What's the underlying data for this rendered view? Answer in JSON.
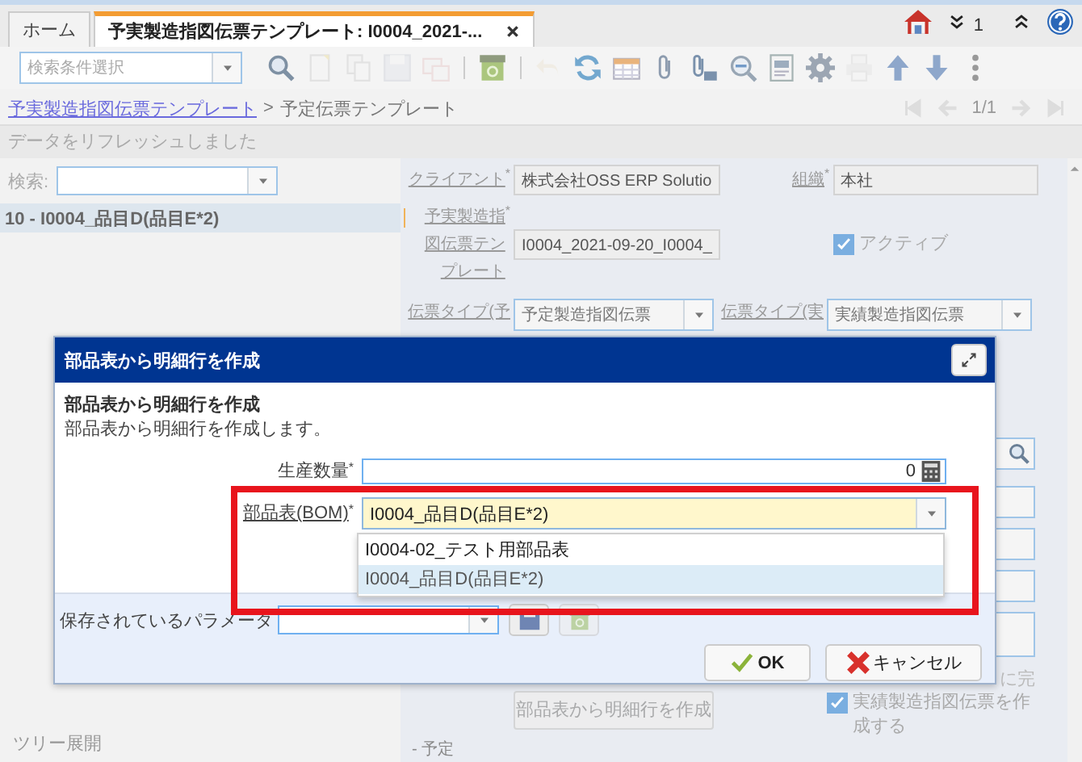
{
  "tabs": [
    {
      "label": "ホーム",
      "selected": false
    },
    {
      "label": "予実製造指図伝票テンプレート: I0004_2021-...",
      "selected": true,
      "closable": true
    }
  ],
  "tab_bar": {
    "window_count": "1"
  },
  "toolbar": {
    "search_combo": {
      "placeholder": "検索条件選択"
    },
    "buttons": [
      {
        "kind": "search",
        "disabled": false
      },
      {
        "kind": "new",
        "disabled": true
      },
      {
        "kind": "copy",
        "disabled": true
      },
      {
        "kind": "save",
        "disabled": true
      },
      {
        "kind": "delete",
        "disabled": true
      },
      {
        "kind": "separator"
      },
      {
        "kind": "archive",
        "disabled": false
      },
      {
        "kind": "separator"
      },
      {
        "kind": "undo",
        "disabled": true
      },
      {
        "kind": "refresh",
        "disabled": false
      },
      {
        "kind": "grid",
        "disabled": false
      },
      {
        "kind": "attach",
        "disabled": false
      },
      {
        "kind": "chat",
        "disabled": false
      },
      {
        "kind": "zoom",
        "disabled": false
      },
      {
        "kind": "report",
        "disabled": false
      },
      {
        "kind": "gear",
        "disabled": false
      },
      {
        "kind": "print",
        "disabled": true
      },
      {
        "kind": "up",
        "disabled": false
      },
      {
        "kind": "down",
        "disabled": false
      },
      {
        "kind": "more",
        "disabled": false
      }
    ]
  },
  "breadcrumb": {
    "link": "予実製造指図伝票テンプレート",
    "separator": ">",
    "current": "予定伝票テンプレート",
    "record": "1/1"
  },
  "status_message": "データをリフレッシュしました",
  "tree_panel": {
    "search_label": "検索:",
    "items": [
      {
        "label": "10 - I0004_品目D(品目E*2)",
        "selected": true
      }
    ],
    "footer": "ツリー展開"
  },
  "form": {
    "rows": [
      {
        "fields": [
          {
            "kind": "text",
            "label": "クライアント",
            "link": true,
            "required_mark": "*",
            "value": "株式会社OSS ERP Solutio"
          },
          {
            "kind": "text",
            "label": "組織",
            "link": true,
            "required_mark": "*",
            "value": "本社"
          }
        ]
      },
      {
        "fields": [
          {
            "kind": "text",
            "label": "予実製造指図伝票テンプレート",
            "link": true,
            "flagged": true,
            "required_mark": "*",
            "value": "I0004_2021-09-20_I0004_"
          },
          {
            "kind": "checkbox",
            "label": "アクティブ",
            "checked": true
          }
        ]
      },
      {
        "fields": [
          {
            "kind": "combo",
            "label": "伝票タイプ(予",
            "link": true,
            "value": "予定製造指図伝票"
          },
          {
            "kind": "combo",
            "label": "伝票タイプ(実",
            "link": true,
            "value": "実績製造指図伝票"
          }
        ]
      }
    ],
    "side_fragment": "に完",
    "lower_row": {
      "fields": [
        {
          "kind": "button",
          "label": "部品表から明細行を作成",
          "disabled": true
        },
        {
          "kind": "checkbox",
          "label": "実績製造指図伝票を作成する",
          "checked": true
        }
      ]
    },
    "section": "- 予定"
  },
  "dialog": {
    "title": "部品表から明細行を作成",
    "heading": "部品表から明細行を作成",
    "description": "部品表から明細行を作成します。",
    "fields": [
      {
        "kind": "number",
        "label": "生産数量",
        "link": false,
        "required_mark": "*",
        "value": "0"
      },
      {
        "kind": "combo",
        "label": "部品表(BOM)",
        "link": true,
        "required_mark": "*",
        "value": "I0004_品目D(品目E*2)"
      }
    ],
    "dropdown": [
      {
        "label": "I0004-02_テスト用部品表",
        "selected": false
      },
      {
        "label": "I0004_品目D(品目E*2)",
        "selected": true
      }
    ],
    "saved_parameters": {
      "label": "保存されているパラメータ"
    },
    "buttons": [
      {
        "kind": "ok",
        "label": "OK"
      },
      {
        "kind": "cancel",
        "label": "キャンセル"
      }
    ]
  },
  "highlight": {
    "kind": "rectangle"
  }
}
